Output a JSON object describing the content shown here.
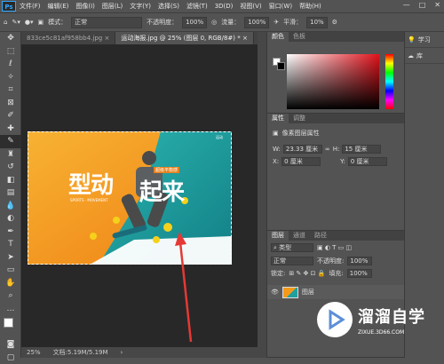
{
  "app": {
    "logo": "Ps"
  },
  "menu": [
    "文件(F)",
    "编辑(E)",
    "图像(I)",
    "图层(L)",
    "文字(Y)",
    "选择(S)",
    "滤镜(T)",
    "3D(D)",
    "视图(V)",
    "窗口(W)",
    "帮助(H)"
  ],
  "window_controls": [
    "—",
    "□",
    "✕"
  ],
  "options": {
    "mode_label": "模式：",
    "mode_value": "正常",
    "opacity_label": "不透明度：",
    "opacity_value": "100%",
    "flow_label": "流量：",
    "flow_value": "100%",
    "smooth_label": "平滑：",
    "smooth_value": "10%"
  },
  "tabs": [
    {
      "label": "833ce5c81af958bb4.jpg",
      "close": "×"
    },
    {
      "label": "运动海报.jpg @ 25% (图层 0, RGB/8#) *",
      "close": "×"
    }
  ],
  "status": {
    "zoom": "25%",
    "doc": "文档:5.19M/5.19M"
  },
  "color_panel": {
    "tabs": [
      "颜色",
      "色板"
    ]
  },
  "properties_panel": {
    "tabs": [
      "属性",
      "调整"
    ],
    "section": "像素图层属性",
    "w_label": "W:",
    "w_value": "23.33 厘米",
    "h_label": "H:",
    "h_value": "15 厘米",
    "x_label": "X:",
    "x_value": "0 厘米",
    "y_label": "Y:",
    "y_value": "0 厘米",
    "link": "∞"
  },
  "layers_panel": {
    "tabs": [
      "图层",
      "通道",
      "路径"
    ],
    "kind_label": "类型",
    "blend_value": "正常",
    "opacity_label": "不透明度:",
    "opacity_value": "100%",
    "lock_label": "锁定:",
    "fill_label": "填充:",
    "fill_value": "100%",
    "layer_name": "图层"
  },
  "right_dock": [
    {
      "label": "学习",
      "icon": "bulb-icon"
    },
    {
      "label": "库",
      "icon": "cloud-icon"
    }
  ],
  "poster": {
    "title_left": "型动",
    "title_right": "起来",
    "tag": "超级平衡感",
    "sub_en": "SPORTS · MOVEMENT",
    "corner": "运动"
  },
  "watermark": {
    "brand": "溜溜自学",
    "url": "ZIXUE.3D66.COM"
  },
  "colors": {
    "accent_orange": "#f39a1a",
    "accent_teal": "#1fa0a0",
    "arrow": "#e53935"
  }
}
